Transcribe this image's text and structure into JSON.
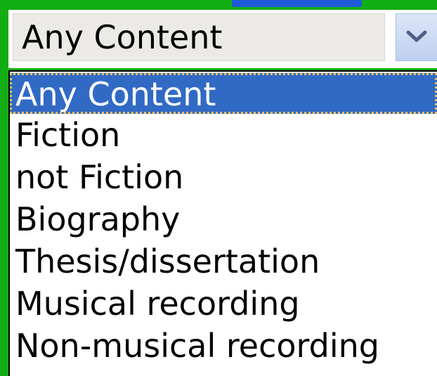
{
  "content_select": {
    "selected_value": "Any Content",
    "dropdown_icon": "chevron-down-icon",
    "options": [
      "Any Content",
      "Fiction",
      "not Fiction",
      "Biography",
      "Thesis/dissertation",
      "Musical recording",
      "Non-musical recording"
    ],
    "highlighted_option": "Any Content"
  },
  "colors": {
    "background": "#12ad12",
    "selection_highlight": "#316ac5",
    "select_button": "#c9d8f4"
  }
}
